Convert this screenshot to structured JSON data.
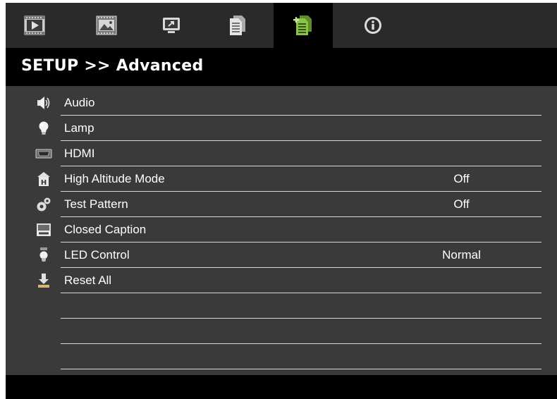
{
  "tabs": [
    {
      "icon": "video-play-icon",
      "active": false
    },
    {
      "icon": "image-icon",
      "active": false
    },
    {
      "icon": "display-arrow-icon",
      "active": false
    },
    {
      "icon": "document-icon",
      "active": false
    },
    {
      "icon": "setup-advanced-icon",
      "active": true
    },
    {
      "icon": "info-icon",
      "active": false
    }
  ],
  "header": {
    "title": "SETUP >> Advanced"
  },
  "menu": {
    "items": [
      {
        "label": "Audio",
        "value": "",
        "icon": "speaker-icon"
      },
      {
        "label": "Lamp",
        "value": "",
        "icon": "lamp-icon"
      },
      {
        "label": "HDMI",
        "value": "",
        "icon": "hdmi-icon"
      },
      {
        "label": "High Altitude Mode",
        "value": "Off",
        "icon": "high-altitude-icon"
      },
      {
        "label": "Test Pattern",
        "value": "Off",
        "icon": "test-pattern-icon"
      },
      {
        "label": "Closed Caption",
        "value": "",
        "icon": "closed-caption-icon"
      },
      {
        "label": "LED Control",
        "value": "Normal",
        "icon": "led-control-icon"
      },
      {
        "label": "Reset All",
        "value": "",
        "icon": "reset-icon"
      }
    ]
  },
  "colors": {
    "accent": "#8bc34a",
    "menu_bg": "#3a3a3a",
    "tab_bar_bg": "#2a2a2a"
  }
}
